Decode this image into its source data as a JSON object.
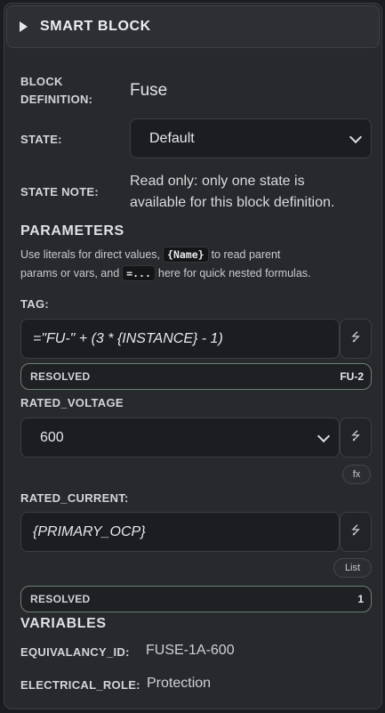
{
  "header": {
    "title": "SMART BLOCK"
  },
  "block_definition": {
    "label_line1": "BLOCK",
    "label_line2": "DEFINITION:",
    "value": "Fuse"
  },
  "state": {
    "label": "STATE:",
    "selected": "Default"
  },
  "state_note": {
    "label": "STATE NOTE:",
    "line1": "Read only: only one state is",
    "line2": "available for this block definition."
  },
  "parameters": {
    "title": "PARAMETERS",
    "help_part1": "Use literals for direct values,",
    "help_code1": "{Name}",
    "help_part2": "to read parent",
    "help_part3": "params or vars, and",
    "help_code2": "=...",
    "help_part4": "here for quick nested formulas.",
    "tag": {
      "label": "TAG:",
      "value": "=\"FU-\" + (3 * {INSTANCE} - 1)",
      "resolved_label": "RESOLVED",
      "resolved_value": "FU-2"
    },
    "rated_voltage": {
      "label": "RATED_VOLTAGE",
      "selected": "600",
      "mode_pill": "fx"
    },
    "rated_current": {
      "label": "RATED_CURRENT:",
      "value": "{PRIMARY_OCP}",
      "mode_pill": "List",
      "resolved_label": "RESOLVED",
      "resolved_value": "1"
    }
  },
  "variables": {
    "title": "VARIABLES",
    "equivalancy_id": {
      "label": "EQUIVALANCY_ID:",
      "value": "FUSE-1A-600"
    },
    "electrical_role": {
      "label": "ELECTRICAL_ROLE:",
      "value": "Protection"
    }
  },
  "icons": {
    "formula_toggle": "lightning-bolt-icon",
    "dropdown": "chevron-down-icon",
    "collapse": "caret-right-icon"
  }
}
